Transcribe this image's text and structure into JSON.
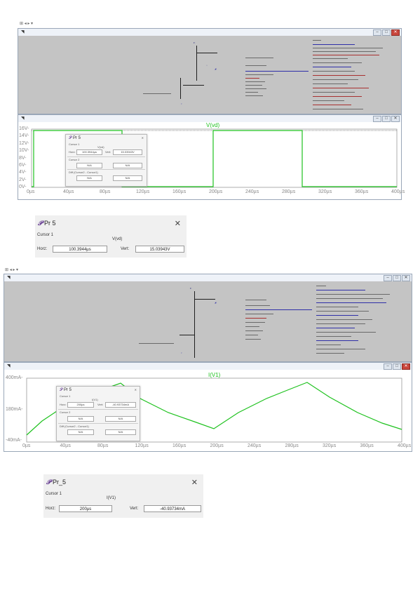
{
  "top_strip": {
    "quick_access": "⊞ ◂ ▸ ▾"
  },
  "schematic1": {
    "title": "◥"
  },
  "waveform1": {
    "title": "◥",
    "trace": "V(vd)",
    "y_ticks": [
      "16V-",
      "14V-",
      "12V-",
      "10V-",
      "8V-",
      "6V-",
      "4V-",
      "2V-",
      "0V-"
    ],
    "x_ticks": [
      "0µs",
      "40µs",
      "80µs",
      "120µs",
      "160µs",
      "200µs",
      "240µs",
      "280µs",
      "320µs",
      "360µs",
      "400µs"
    ],
    "trace_color": "#1fc21f"
  },
  "cursor_popup1": {
    "title": "Pr 5",
    "cursor1_label": "Cursor 1",
    "cursor1_trace": "V(vd)",
    "horz_label": "Horz:",
    "horz_value": "100.3944µs",
    "vert_label": "Vert:",
    "vert_value": "15.03943V",
    "cursor2_label": "Cursor 2",
    "cursor2_horz": "N/A",
    "cursor2_vert": "N/A",
    "diff_label": "Diff (Cursor2 - Cursor1)",
    "diff_horz": "N/A",
    "diff_vert": "N/A"
  },
  "cursor_dialog1": {
    "title": "Pr 5",
    "close": "✕",
    "cursor_label": "Cursor 1",
    "trace": "V(vd)",
    "horz_label": "Horz:",
    "horz_value": "100.3944µs",
    "vert_label": "Vert:",
    "vert_value": "15.03943V"
  },
  "schematic2": {
    "title": "◥"
  },
  "waveform2": {
    "title": "◥",
    "trace": "I(V1)",
    "y_ticks": [
      "400mA-",
      "180mA-",
      "-40mA-"
    ],
    "x_ticks": [
      "0µs",
      "40µs",
      "80µs",
      "120µs",
      "160µs",
      "200µs",
      "240µs",
      "280µs",
      "320µs",
      "360µs",
      "400µs"
    ],
    "trace_color": "#1fc21f"
  },
  "cursor_popup2": {
    "title": "Pr 5",
    "cursor1_label": "Cursor 1",
    "cursor1_trace": "I(V1)",
    "horz_label": "Horz:",
    "horz_value": "200µs",
    "vert_label": "Vert:",
    "vert_value": "-40.93734mA",
    "cursor2_label": "Cursor 2",
    "cursor2_horz": "N/A",
    "cursor2_vert": "N/A",
    "diff_label": "Diff (Cursor2 - Cursor1)",
    "diff_horz": "N/A",
    "diff_vert": "N/A"
  },
  "cursor_dialog2": {
    "title": "Pr_5",
    "close": "✕",
    "cursor_label": "Cursor 1",
    "trace": "I(V1)",
    "horz_label": "Horz:",
    "horz_value": "200µs",
    "vert_label": "Vert:",
    "vert_value": "-40.93734mA"
  }
}
